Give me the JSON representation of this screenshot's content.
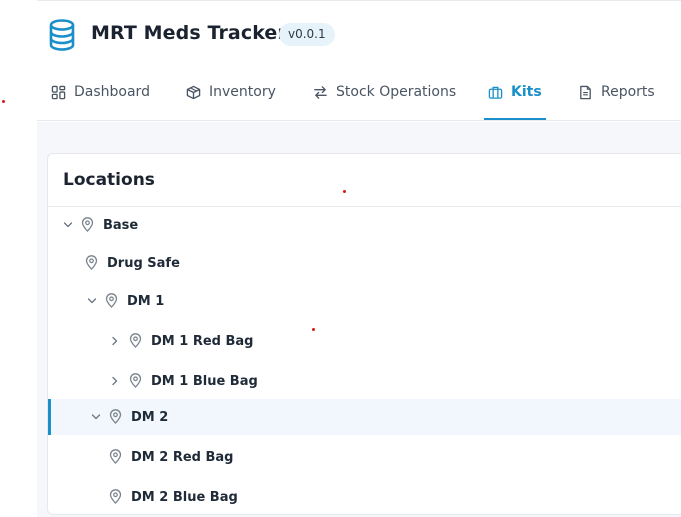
{
  "app": {
    "title": "MRT Meds Tracker",
    "version": "v0.0.1",
    "brand_color": "#1b8fc9"
  },
  "nav": {
    "tabs": [
      {
        "label": "Dashboard",
        "icon": "dashboard-icon",
        "active": false
      },
      {
        "label": "Inventory",
        "icon": "box-icon",
        "active": false
      },
      {
        "label": "Stock Operations",
        "icon": "swap-arrows-icon",
        "active": false
      },
      {
        "label": "Kits",
        "icon": "kit-bag-icon",
        "active": true
      },
      {
        "label": "Reports",
        "icon": "document-icon",
        "active": false
      }
    ]
  },
  "locations": {
    "title": "Locations",
    "tree": [
      {
        "label": "Base",
        "expander": "expanded",
        "selected": false
      },
      {
        "label": "Drug Safe",
        "expander": "none",
        "selected": false
      },
      {
        "label": "DM 1",
        "expander": "expanded",
        "selected": false
      },
      {
        "label": "DM 1 Red Bag",
        "expander": "collapsed",
        "selected": false
      },
      {
        "label": "DM 1 Blue Bag",
        "expander": "collapsed",
        "selected": false
      },
      {
        "label": "DM 2",
        "expander": "expanded",
        "selected": true
      },
      {
        "label": "DM 2 Red Bag",
        "expander": "none",
        "selected": false
      },
      {
        "label": "DM 2 Blue Bag",
        "expander": "none",
        "selected": false
      }
    ]
  }
}
